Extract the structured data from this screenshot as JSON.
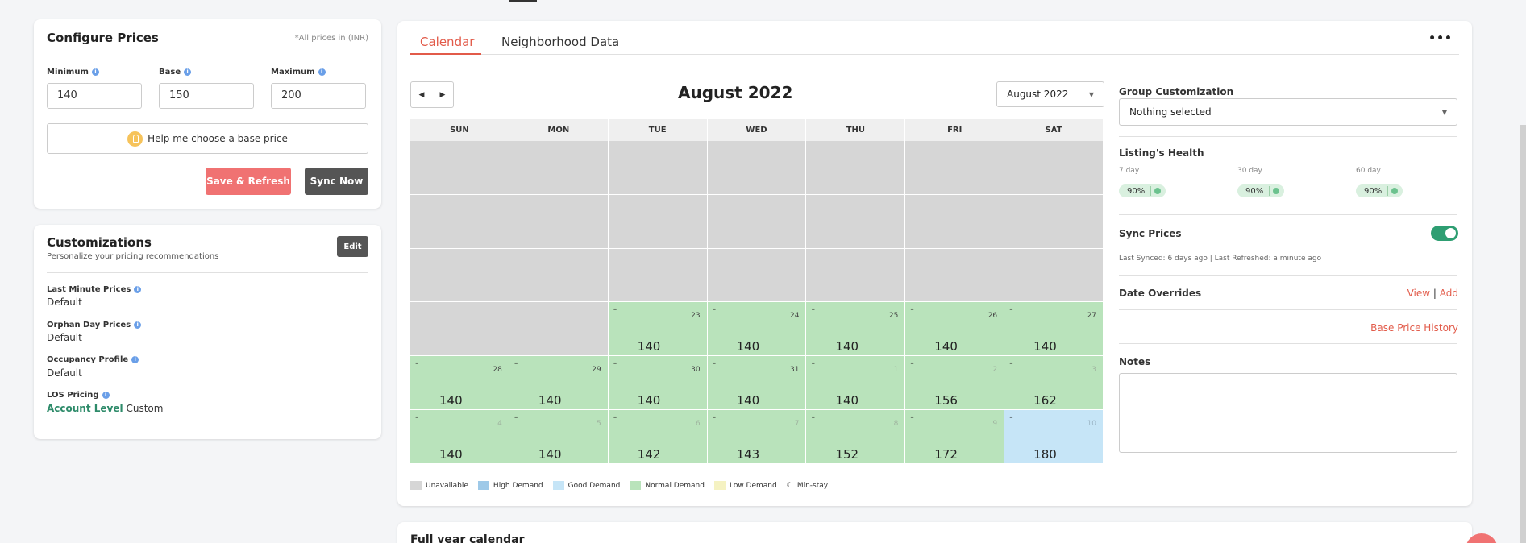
{
  "configure": {
    "title": "Configure Prices",
    "note": "*All prices in (INR)",
    "fields": [
      {
        "label": "Minimum",
        "value": "140"
      },
      {
        "label": "Base",
        "value": "150"
      },
      {
        "label": "Maximum",
        "value": "200"
      }
    ],
    "help_label": "Help me choose a base price",
    "save_label": "Save & Refresh",
    "sync_label": "Sync Now"
  },
  "customizations": {
    "title": "Customizations",
    "subtitle": "Personalize your pricing recommendations",
    "edit_label": "Edit",
    "items": [
      {
        "label": "Last Minute Prices",
        "value": "Default"
      },
      {
        "label": "Orphan Day Prices",
        "value": "Default"
      },
      {
        "label": "Occupancy Profile",
        "value": "Default"
      },
      {
        "label": "LOS Pricing",
        "value_link": "Account Level",
        "value": "Custom"
      }
    ]
  },
  "tabs": [
    {
      "label": "Calendar",
      "active": true
    },
    {
      "label": "Neighborhood Data",
      "active": false
    }
  ],
  "more_label": "•••",
  "calendar": {
    "title": "August 2022",
    "month_select": "August 2022",
    "prev_icon": "◀",
    "next_icon": "▶",
    "days": [
      "SUN",
      "MON",
      "TUE",
      "WED",
      "THU",
      "FRI",
      "SAT"
    ],
    "weeks": [
      [
        {
          "t": "u"
        },
        {
          "t": "u"
        },
        {
          "t": "u"
        },
        {
          "t": "u"
        },
        {
          "t": "u"
        },
        {
          "t": "u"
        },
        {
          "t": "u"
        }
      ],
      [
        {
          "t": "u"
        },
        {
          "t": "u"
        },
        {
          "t": "u"
        },
        {
          "t": "u"
        },
        {
          "t": "u"
        },
        {
          "t": "u"
        },
        {
          "t": "u"
        }
      ],
      [
        {
          "t": "u"
        },
        {
          "t": "u"
        },
        {
          "t": "u"
        },
        {
          "t": "u"
        },
        {
          "t": "u"
        },
        {
          "t": "u"
        },
        {
          "t": "u"
        }
      ],
      [
        {
          "t": "u"
        },
        {
          "t": "u"
        },
        {
          "t": "n",
          "d": "23",
          "p": "140"
        },
        {
          "t": "n",
          "d": "24",
          "p": "140"
        },
        {
          "t": "n",
          "d": "25",
          "p": "140"
        },
        {
          "t": "n",
          "d": "26",
          "p": "140"
        },
        {
          "t": "n",
          "d": "27",
          "p": "140"
        }
      ],
      [
        {
          "t": "n",
          "d": "28",
          "p": "140"
        },
        {
          "t": "n",
          "d": "29",
          "p": "140"
        },
        {
          "t": "n",
          "d": "30",
          "p": "140"
        },
        {
          "t": "n",
          "d": "31",
          "p": "140"
        },
        {
          "t": "n",
          "d": "1",
          "p": "140",
          "m": true
        },
        {
          "t": "n",
          "d": "2",
          "p": "156",
          "m": true
        },
        {
          "t": "n",
          "d": "3",
          "p": "162",
          "m": true
        }
      ],
      [
        {
          "t": "n",
          "d": "4",
          "p": "140",
          "m": true
        },
        {
          "t": "n",
          "d": "5",
          "p": "140",
          "m": true
        },
        {
          "t": "n",
          "d": "6",
          "p": "142",
          "m": true
        },
        {
          "t": "n",
          "d": "7",
          "p": "143",
          "m": true
        },
        {
          "t": "n",
          "d": "8",
          "p": "152",
          "m": true
        },
        {
          "t": "n",
          "d": "9",
          "p": "172",
          "m": true
        },
        {
          "t": "g",
          "d": "10",
          "p": "180",
          "m": true
        }
      ]
    ],
    "legend": [
      {
        "label": "Unavailable",
        "color": "#d6d6d6"
      },
      {
        "label": "High Demand",
        "color": "#9ec9e8"
      },
      {
        "label": "Good Demand",
        "color": "#c6e5f7"
      },
      {
        "label": "Normal Demand",
        "color": "#b9e3bb"
      },
      {
        "label": "Low Demand",
        "color": "#f5f2c2"
      }
    ],
    "min_stay_label": "Min-stay"
  },
  "right": {
    "group_label": "Group Customization",
    "group_value": "Nothing selected",
    "health_label": "Listing's Health",
    "health": [
      {
        "day": "7 day",
        "value": "90%"
      },
      {
        "day": "30 day",
        "value": "90%"
      },
      {
        "day": "60 day",
        "value": "90%"
      }
    ],
    "sync_label": "Sync Prices",
    "last_synced": "Last Synced: 6 days ago | Last Refreshed: a minute ago",
    "overrides_label": "Date Overrides",
    "view_label": "View",
    "add_label": "Add",
    "bph_label": "Base Price History",
    "notes_label": "Notes"
  },
  "full_year": {
    "title": "Full year calendar"
  }
}
